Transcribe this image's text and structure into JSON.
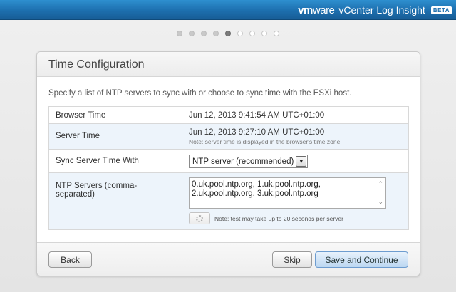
{
  "brand": {
    "logo_vm": "vm",
    "logo_ware": "ware",
    "app_name": "vCenter Log Insight",
    "badge": "BETA"
  },
  "steps": {
    "total": 9,
    "current": 5
  },
  "panel": {
    "title": "Time Configuration",
    "description": "Specify a list of NTP servers to sync with or choose to sync time with the ESXi host."
  },
  "rows": {
    "browser_time": {
      "label": "Browser Time",
      "value": "Jun 12, 2013 9:41:54 AM UTC+01:00"
    },
    "server_time": {
      "label": "Server Time",
      "value": "Jun 12, 2013 9:27:10 AM UTC+01:00",
      "note": "Note: server time is displayed in the browser's time zone"
    },
    "sync_with": {
      "label": "Sync Server Time With",
      "selected": "NTP server (recommended)"
    },
    "ntp_servers": {
      "label": "NTP Servers (comma-separated)",
      "line1": "0.uk.pool.ntp.org, 1.uk.pool.ntp.org,",
      "line2": "2.uk.pool.ntp.org, 3.uk.pool.ntp.org",
      "test_note": "Note: test may take up to 20 seconds per server"
    }
  },
  "footer": {
    "back_label": "Back",
    "skip_label": "Skip",
    "save_label": "Save and Continue"
  }
}
